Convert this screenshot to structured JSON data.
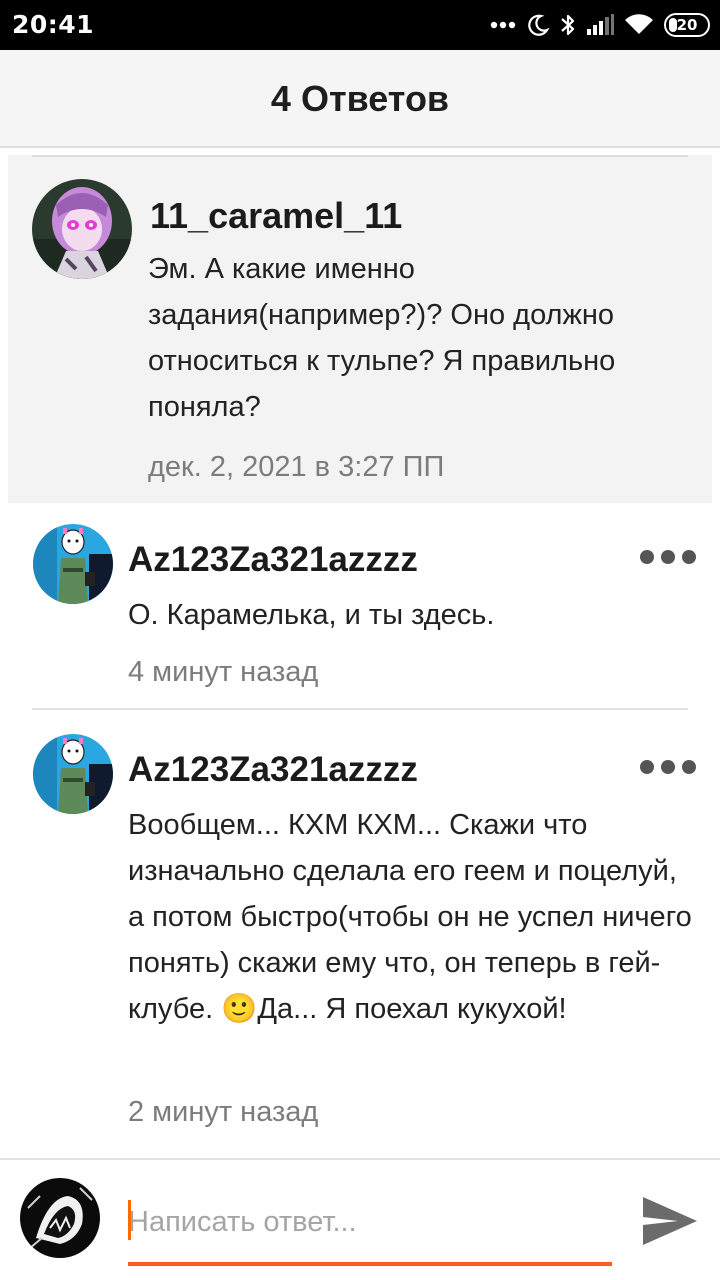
{
  "status_bar": {
    "time": "20:41",
    "battery_level": "20",
    "icons": [
      "more-dots-icon",
      "moon-icon",
      "bluetooth-icon",
      "signal-icon",
      "wifi-icon",
      "battery-icon"
    ]
  },
  "header": {
    "title": "4 Ответов"
  },
  "parent_comment": {
    "username": "11_caramel_11",
    "text": "Эм. А какие именно задания(например?)? Оно должно относиться к тульпе? Я правильно поняла?",
    "timestamp": "дек. 2, 2021 в 3:27 ПП"
  },
  "replies": [
    {
      "username": "Az123Za321azzzz",
      "text": "О. Карамелька, и ты здесь.",
      "timestamp": "4 минут назад"
    },
    {
      "username": "Az123Za321azzzz",
      "text": "Вообщем... КХМ КХМ... Скажи что изначально сделала его геем и поцелуй, а потом быстро(чтобы он не успел ничего понять) скажи ему что, он теперь в гей-клубе. 🙂Да... Я поехал кукухой!",
      "timestamp": "2 минут назад"
    }
  ],
  "reply_input": {
    "placeholder": "Написать ответ..."
  },
  "colors": {
    "accent": "#ff5a1f",
    "highlight_bg": "#f3f3f3",
    "header_bg": "#f5f5f5"
  }
}
